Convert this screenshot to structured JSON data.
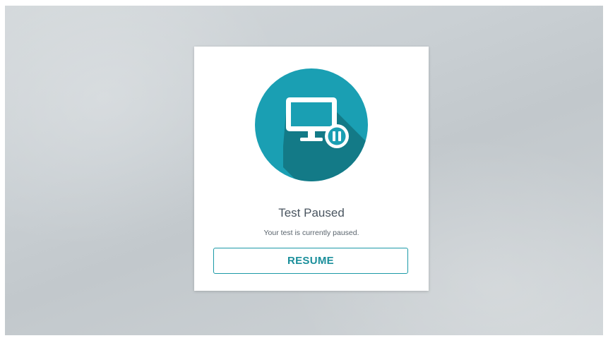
{
  "dialog": {
    "title": "Test Paused",
    "message": "Your test is currently paused.",
    "resume_label": "RESUME"
  },
  "icons": {
    "status": "monitor-pause-icon"
  },
  "colors": {
    "icon_circle": "#1a9fb3",
    "icon_shadow": "#137582",
    "accent": "#1b9aa7",
    "background": "#c6ccd0"
  }
}
